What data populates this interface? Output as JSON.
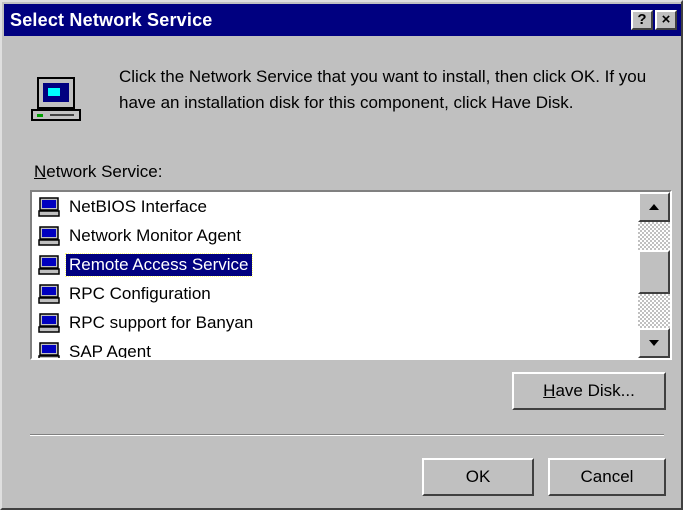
{
  "dialog": {
    "title": "Select Network Service",
    "help_glyph": "?",
    "close_glyph": "×",
    "instructions": "Click the Network Service that you want to install, then click OK.  If you have an installation disk for this component, click Have Disk.",
    "list_label_accel": "N",
    "list_label_rest": "etwork Service:",
    "list_items": [
      {
        "label": "NetBIOS Interface",
        "selected": false
      },
      {
        "label": "Network Monitor Agent",
        "selected": false
      },
      {
        "label": "Remote Access Service",
        "selected": true
      },
      {
        "label": "RPC Configuration",
        "selected": false
      },
      {
        "label": "RPC support for Banyan",
        "selected": false
      },
      {
        "label": "SAP Agent",
        "selected": false
      }
    ],
    "have_disk_accel": "H",
    "have_disk_rest": "ave Disk...",
    "ok_label": "OK",
    "cancel_label": "Cancel"
  },
  "colors": {
    "face": "#c0c0c0",
    "titlebar": "#000080",
    "selection": "#000080"
  },
  "icons": {
    "header": "computer-icon",
    "list_item": "network-computer-icon",
    "scroll_up": "arrow-up-icon",
    "scroll_down": "arrow-down-icon"
  }
}
